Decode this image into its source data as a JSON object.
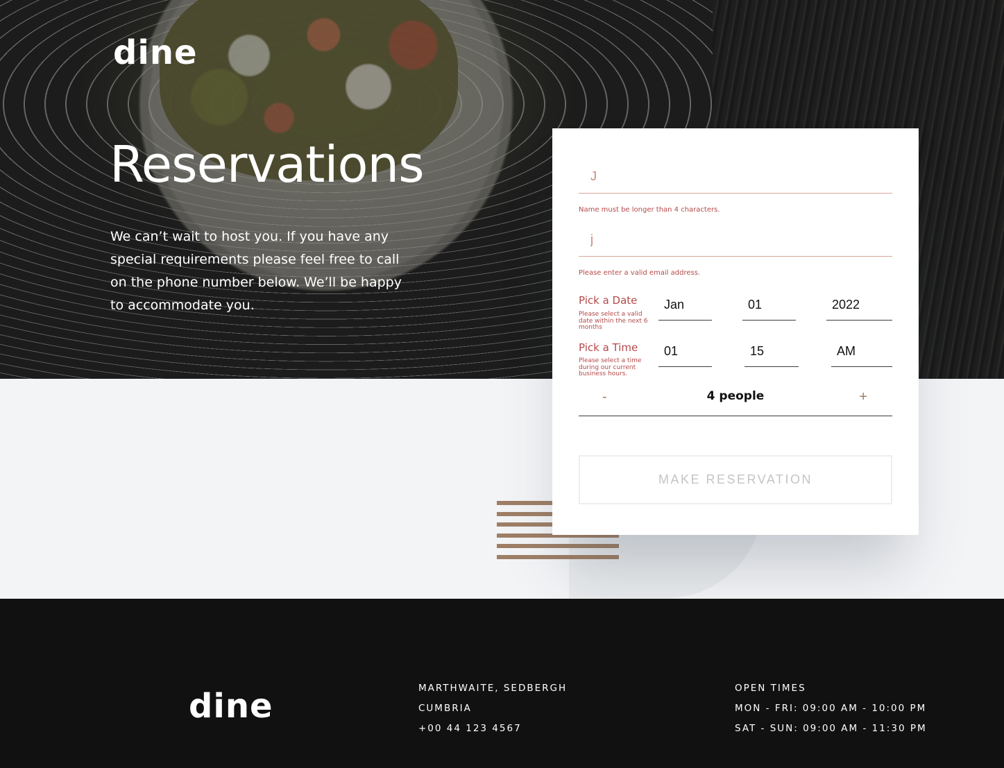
{
  "header": {
    "logo": "dine"
  },
  "hero": {
    "title": "Reservations",
    "text": "We can’t wait to host you. If you have any special requirements please feel free to call on the phone number below. We’ll be happy to accommodate you."
  },
  "form": {
    "name": {
      "value": "J",
      "error": "Name must be longer than 4 characters."
    },
    "email": {
      "value": "j",
      "error": "Please enter a valid email address."
    },
    "date": {
      "label": "Pick a Date",
      "hint": "Please select a valid date within the next 6 months",
      "month": "Jan",
      "day": "01",
      "year": "2022"
    },
    "time": {
      "label": "Pick a Time",
      "hint": "Please select a time during our current business hours.",
      "hour": "01",
      "minute": "15",
      "period": "AM"
    },
    "people": {
      "decrement": "-",
      "count": "4 people",
      "increment": "+"
    },
    "submit_label": "MAKE RESERVATION"
  },
  "footer": {
    "logo": "dine",
    "address": [
      "MARTHWAITE, SEDBERGH",
      "CUMBRIA",
      "+00 44 123 4567"
    ],
    "hours": [
      "OPEN TIMES",
      "MON - FRI: 09:00 AM - 10:00 PM",
      "SAT - SUN: 09:00 AM - 11:30 PM"
    ]
  },
  "colors": {
    "accent": "#9e7f66",
    "error": "#b54949",
    "footer_bg": "#111111",
    "page_bg": "#f3f4f6"
  }
}
